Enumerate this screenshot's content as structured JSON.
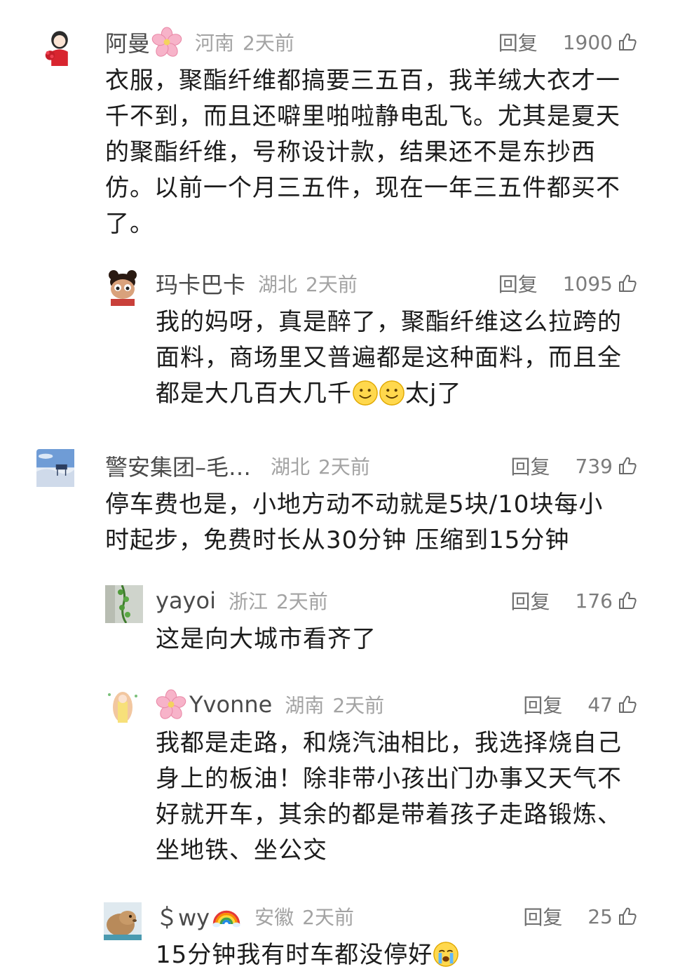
{
  "comments": [
    {
      "name": "阿曼",
      "location": "河南",
      "time": "2天前",
      "reply": "回复",
      "likes": "1900",
      "text": "衣服，聚酯纤维都搞要三五百，我羊绒大衣才一千不到，而且还噼里啪啦静电乱飞。尤其是夏天的聚酯纤维，号称设计款，结果还不是东抄西仿。以前一个月三五件，现在一年三五件都买不了。"
    },
    {
      "name": "玛卡巴卡",
      "location": "湖北",
      "time": "2天前",
      "reply": "回复",
      "likes": "1095",
      "text_a": "我的妈呀，真是醉了，聚酯纤维这么拉跨的面料，商场里又普遍都是这种面料，而且全都是大几百大几千",
      "text_b": "太j了"
    },
    {
      "name": "警安集团–毛…",
      "location": "湖北",
      "time": "2天前",
      "reply": "回复",
      "likes": "739",
      "text": "停车费也是，小地方动不动就是5块/10块每小时起步，免费时长从30分钟 压缩到15分钟"
    },
    {
      "name": "yayoi",
      "location": "浙江",
      "time": "2天前",
      "reply": "回复",
      "likes": "176",
      "text": "这是向大城市看齐了"
    },
    {
      "name": "Yvonne",
      "location": "湖南",
      "time": "2天前",
      "reply": "回复",
      "likes": "47",
      "text": "我都是走路，和烧汽油相比，我选择烧自己身上的板油！除非带小孩出门办事又天气不好就开车，其余的都是带着孩子走路锻炼、坐地铁、坐公交"
    },
    {
      "name": "＄wy",
      "location": "安徽",
      "time": "2天前",
      "reply": "回复",
      "likes": "25",
      "text": "15分钟我有时车都没停好"
    }
  ],
  "icons": {
    "like": "thumb-up-icon",
    "flower": "cherry-blossom-emoji",
    "rainbow": "rainbow-emoji",
    "smile": "smile-emoji",
    "cry": "crying-emoji"
  }
}
